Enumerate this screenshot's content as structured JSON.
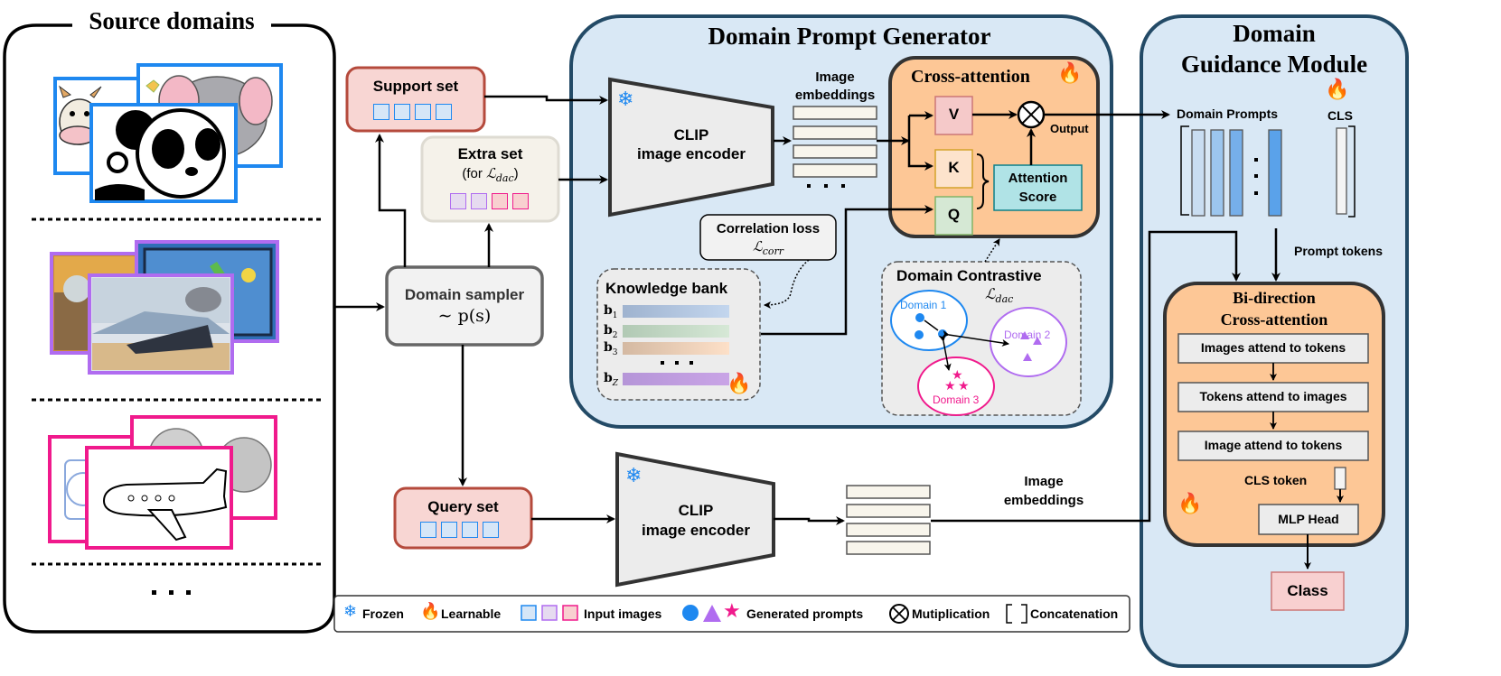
{
  "source_domains": {
    "title": "Source domains",
    "groups": [
      {
        "name": "cartoon",
        "border_color": "#1e88f0",
        "images": [
          "cow",
          "elephant",
          "panda"
        ]
      },
      {
        "name": "painting",
        "border_color": "#b06cf0",
        "images": [
          "autumn-painting",
          "abstract-painting",
          "train-painting"
        ]
      },
      {
        "name": "sketch",
        "border_color": "#f01a8c",
        "images": [
          "watch-sketch",
          "apple-sketch",
          "airplane-sketch"
        ]
      }
    ],
    "ellipsis": "· · ·"
  },
  "support_set": {
    "label": "Support set",
    "squares": [
      "#1e88f0",
      "#1e88f0",
      "#1e88f0",
      "#1e88f0"
    ]
  },
  "extra_set": {
    "label": "Extra set",
    "sub_prefix": "(for ",
    "sub_math": "ℒ",
    "sub_math_sub": "dac",
    "sub_suffix": ")",
    "squares": [
      "#b06cf0",
      "#b06cf0",
      "#f01a8c",
      "#f01a8c"
    ]
  },
  "domain_sampler": {
    "label": "Domain sampler",
    "formula": "∼ p(s)"
  },
  "query_set": {
    "label": "Query set",
    "squares": [
      "#1e88f0",
      "#1e88f0",
      "#1e88f0",
      "#1e88f0"
    ]
  },
  "domain_prompt_generator": {
    "title": "Domain Prompt Generator",
    "encoder": {
      "line1": "CLIP",
      "line2": "image encoder"
    },
    "embeddings_label_1": "Image",
    "embeddings_label_2": "embeddings",
    "cross_attention": {
      "title": "Cross-attention",
      "v": "V",
      "k": "K",
      "q": "Q",
      "score_1": "Attention",
      "score_2": "Score",
      "output": "Output"
    },
    "correlation_loss": {
      "label": "Correlation loss",
      "math": "ℒ",
      "math_sub": "corr"
    },
    "knowledge_bank": {
      "title": "Knowledge bank",
      "rows": [
        {
          "label": "b",
          "sub": "1"
        },
        {
          "label": "b",
          "sub": "2"
        },
        {
          "label": "b",
          "sub": "3"
        },
        {
          "label": "b",
          "sub": "Z"
        }
      ]
    },
    "domain_contrastive": {
      "title": "Domain Contrastive",
      "math": "ℒ",
      "math_sub": "dac",
      "domains": [
        "Domain 1",
        "Domain 2",
        "Domain 3"
      ]
    }
  },
  "query_branch": {
    "encoder": {
      "line1": "CLIP",
      "line2": "image encoder"
    },
    "embeddings_label_1": "Image",
    "embeddings_label_2": "embeddings"
  },
  "domain_guidance_module": {
    "title_1": "Domain",
    "title_2": "Guidance Module",
    "domain_prompts_label": "Domain Prompts",
    "cls_label": "CLS",
    "prompt_tokens_label": "Prompt tokens",
    "bi_direction": {
      "title_1": "Bi-direction",
      "title_2": "Cross-attention",
      "steps": [
        "Images attend to tokens",
        "Tokens attend to images",
        "Image attend to tokens"
      ],
      "cls_token": "CLS token",
      "mlp_head": "MLP Head"
    },
    "class_label": "Class"
  },
  "legend": {
    "frozen": "Frozen",
    "learnable": "Learnable",
    "input_images": "Input images",
    "generated_prompts": "Generated prompts",
    "multiplication": "Mutiplication",
    "concatenation": "Concatenation"
  },
  "colors": {
    "blue_domain": "#1e88f0",
    "purple_domain": "#b06cf0",
    "pink_domain": "#f01a8c",
    "panel_bg": "#d9e8f5",
    "panel_border": "#234a66",
    "orange_bg": "#fdc796",
    "set_red_bg": "#f8d6d3",
    "set_red_border": "#b54a3c"
  }
}
